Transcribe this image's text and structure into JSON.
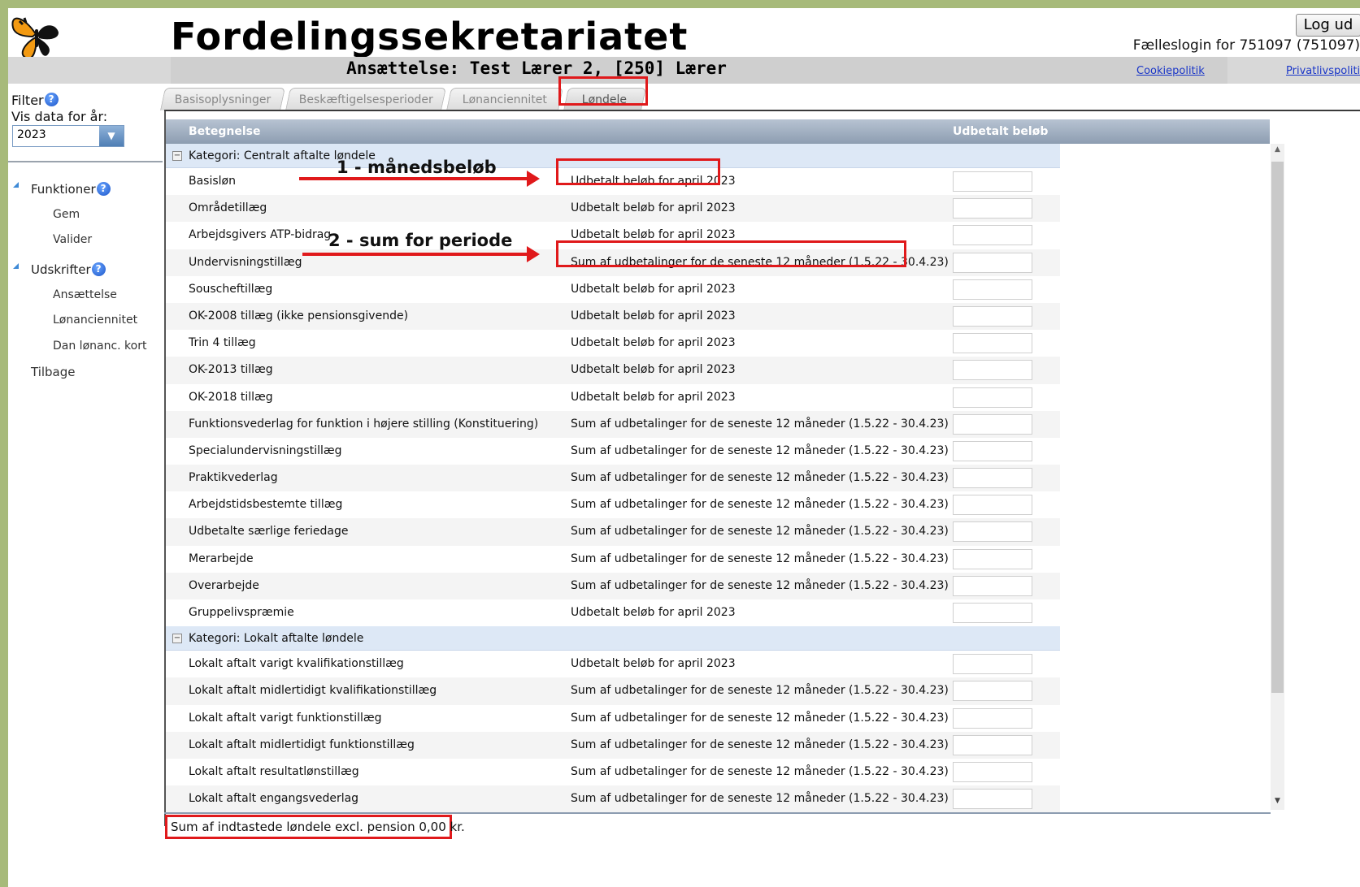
{
  "header": {
    "app_title": "Fordelingssekretariatet",
    "logout_label": "Log ud",
    "login_info": "Fælleslogin for 751097 (751097)",
    "employment_title": "Ansættelse: Test Lærer 2, [250] Lærer",
    "cookie_link": "Cookiepolitik",
    "privacy_link": "Privatlivspolitik"
  },
  "filter": {
    "filter_label": "Filter",
    "year_label": "Vis data for år:",
    "year_value": "2023"
  },
  "nav": {
    "functions_label": "Funktioner",
    "functions": [
      "Gem",
      "Valider"
    ],
    "printouts_label": "Udskrifter",
    "printouts": [
      "Ansættelse",
      "Lønanciennitet",
      "Dan lønanc. kort"
    ],
    "back_label": "Tilbage"
  },
  "tabs": [
    "Basisoplysninger",
    "Beskæftigelsesperioder",
    "Lønanciennitet",
    "Løndele"
  ],
  "active_tab": "Løndele",
  "grid": {
    "col_name": "Betegnelse",
    "col_amount": "Udbetalt beløb",
    "categories": [
      {
        "label": "Kategori: Centralt aftalte løndele",
        "toggle": "−",
        "rows": [
          {
            "name": "Basisløn",
            "desc": "Udbetalt beløb for april 2023",
            "amount": ""
          },
          {
            "name": "Områdetillæg",
            "desc": "Udbetalt beløb for april 2023",
            "amount": ""
          },
          {
            "name": "Arbejdsgivers ATP-bidrag",
            "desc": "Udbetalt beløb for april 2023",
            "amount": ""
          },
          {
            "name": "Undervisningstillæg",
            "desc": "Sum af udbetalinger for de seneste 12 måneder (1.5.22 - 30.4.23)",
            "amount": ""
          },
          {
            "name": "Souscheftillæg",
            "desc": "Udbetalt beløb for april 2023",
            "amount": ""
          },
          {
            "name": "OK-2008 tillæg (ikke pensionsgivende)",
            "desc": "Udbetalt beløb for april 2023",
            "amount": ""
          },
          {
            "name": "Trin 4 tillæg",
            "desc": "Udbetalt beløb for april 2023",
            "amount": ""
          },
          {
            "name": "OK-2013 tillæg",
            "desc": "Udbetalt beløb for april 2023",
            "amount": ""
          },
          {
            "name": "OK-2018 tillæg",
            "desc": "Udbetalt beløb for april 2023",
            "amount": ""
          },
          {
            "name": "Funktionsvederlag for funktion i højere stilling (Konstituering)",
            "desc": "Sum af udbetalinger for de seneste 12 måneder (1.5.22 - 30.4.23)",
            "amount": ""
          },
          {
            "name": "Specialundervisningstillæg",
            "desc": "Sum af udbetalinger for de seneste 12 måneder (1.5.22 - 30.4.23)",
            "amount": ""
          },
          {
            "name": "Praktikvederlag",
            "desc": "Sum af udbetalinger for de seneste 12 måneder (1.5.22 - 30.4.23)",
            "amount": ""
          },
          {
            "name": "Arbejdstidsbestemte tillæg",
            "desc": "Sum af udbetalinger for de seneste 12 måneder (1.5.22 - 30.4.23)",
            "amount": ""
          },
          {
            "name": "Udbetalte særlige feriedage",
            "desc": "Sum af udbetalinger for de seneste 12 måneder (1.5.22 - 30.4.23)",
            "amount": ""
          },
          {
            "name": "Merarbejde",
            "desc": "Sum af udbetalinger for de seneste 12 måneder (1.5.22 - 30.4.23)",
            "amount": ""
          },
          {
            "name": "Overarbejde",
            "desc": "Sum af udbetalinger for de seneste 12 måneder (1.5.22 - 30.4.23)",
            "amount": ""
          },
          {
            "name": "Gruppelivspræmie",
            "desc": "Udbetalt beløb for april 2023",
            "amount": ""
          }
        ]
      },
      {
        "label": "Kategori: Lokalt aftalte løndele",
        "toggle": "−",
        "rows": [
          {
            "name": "Lokalt aftalt varigt kvalifikationstillæg",
            "desc": "Udbetalt beløb for april 2023",
            "amount": ""
          },
          {
            "name": "Lokalt aftalt midlertidigt kvalifikationstillæg",
            "desc": "Sum af udbetalinger for de seneste 12 måneder (1.5.22 - 30.4.23)",
            "amount": ""
          },
          {
            "name": "Lokalt aftalt varigt funktionstillæg",
            "desc": "Sum af udbetalinger for de seneste 12 måneder (1.5.22 - 30.4.23)",
            "amount": ""
          },
          {
            "name": "Lokalt aftalt midlertidigt funktionstillæg",
            "desc": "Sum af udbetalinger for de seneste 12 måneder (1.5.22 - 30.4.23)",
            "amount": ""
          },
          {
            "name": "Lokalt aftalt resultatlønstillæg",
            "desc": "Sum af udbetalinger for de seneste 12 måneder (1.5.22 - 30.4.23)",
            "amount": ""
          },
          {
            "name": "Lokalt aftalt engangsvederlag",
            "desc": "Sum af udbetalinger for de seneste 12 måneder (1.5.22 - 30.4.23)",
            "amount": ""
          }
        ]
      }
    ]
  },
  "summary": "Sum af indtastede løndele excl. pension 0,00 kr.",
  "annotations": {
    "monthly": "1 - månedsbeløb",
    "period": "2 - sum for periode"
  },
  "colors": {
    "highlight_red": "#e0191b",
    "category_bg": "#dde8f6",
    "header_bg": "#8d9db1",
    "link_blue": "#1a36c8",
    "outer_green": "#a7ba7a"
  },
  "icons": [
    "butterfly-logo-icon",
    "help-icon",
    "expand-triangle-icon",
    "dropdown-arrow-icon",
    "collapse-minus-icon"
  ]
}
